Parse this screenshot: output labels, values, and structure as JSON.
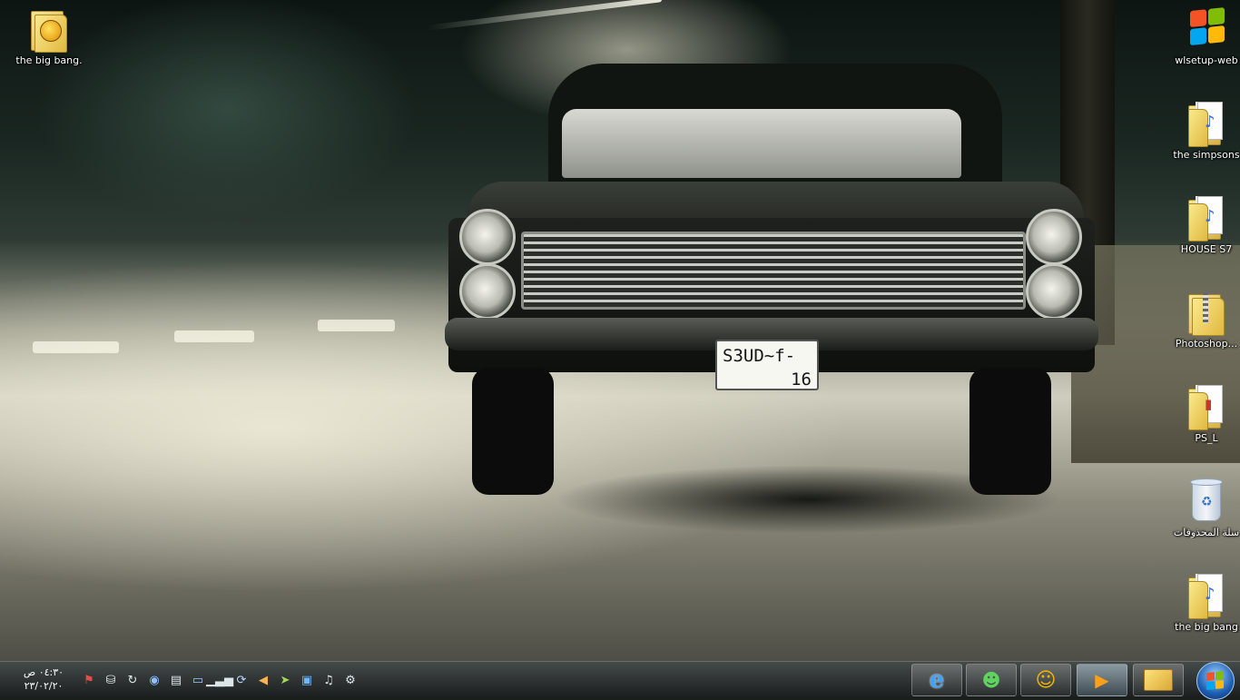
{
  "desktop": {
    "icons_left": [
      {
        "label": "the big bang."
      }
    ],
    "icons_right": [
      {
        "label": "wlsetup-web"
      },
      {
        "label": "the simpsons"
      },
      {
        "label": "HOUSE S7"
      },
      {
        "label": "Photoshop..."
      },
      {
        "label": "PS_L"
      },
      {
        "label": "سلة المحذوفات"
      },
      {
        "label": "the big bang"
      }
    ]
  },
  "wallpaper": {
    "plate_line1": "S3UD~f-",
    "plate_line2": "16"
  },
  "taskbar": {
    "clock_time": "٠٤:٣٠ ص",
    "clock_date": "٢٣/٠٢/٢٠",
    "tray_icons": [
      "flag-error-icon",
      "usb-icon",
      "refresh-icon",
      "media-disc-icon",
      "clipboard-icon",
      "monitor-icon",
      "signal-bars-icon",
      "sync-icon",
      "speaker-muted-icon",
      "arrow-tray-icon",
      "network-icon",
      "volume-icon",
      "settings-tray-icon"
    ],
    "pinned": [
      "internet-explorer-icon",
      "messenger-icon",
      "game-icon",
      "media-player-icon",
      "explorer-folder-icon"
    ],
    "start": "windows-start-icon"
  },
  "colors": {
    "folder": "#e8c85a",
    "taskbar": "#262b2b",
    "win_red": "#f35325",
    "win_green": "#81bc06",
    "win_blue": "#05a6f0",
    "win_yellow": "#ffba08"
  }
}
